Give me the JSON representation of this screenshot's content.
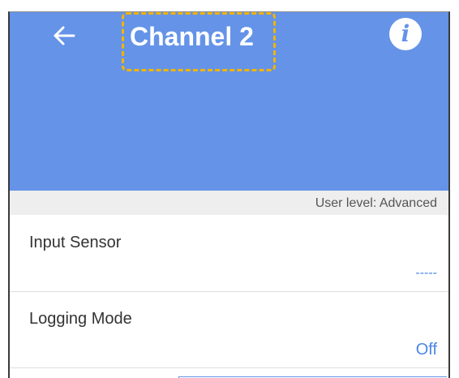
{
  "header": {
    "title": "Channel 2",
    "back_icon": "arrow-back-icon",
    "info_icon": "info-icon",
    "info_glyph": "i",
    "color": "#6493e8",
    "highlight_color": "#f2b400"
  },
  "user_level": {
    "text": "User level: Advanced"
  },
  "settings": [
    {
      "label": "Input Sensor",
      "value": "-----"
    },
    {
      "label": "Logging Mode",
      "value": "Off"
    }
  ],
  "accent_color": "#4a86e8"
}
